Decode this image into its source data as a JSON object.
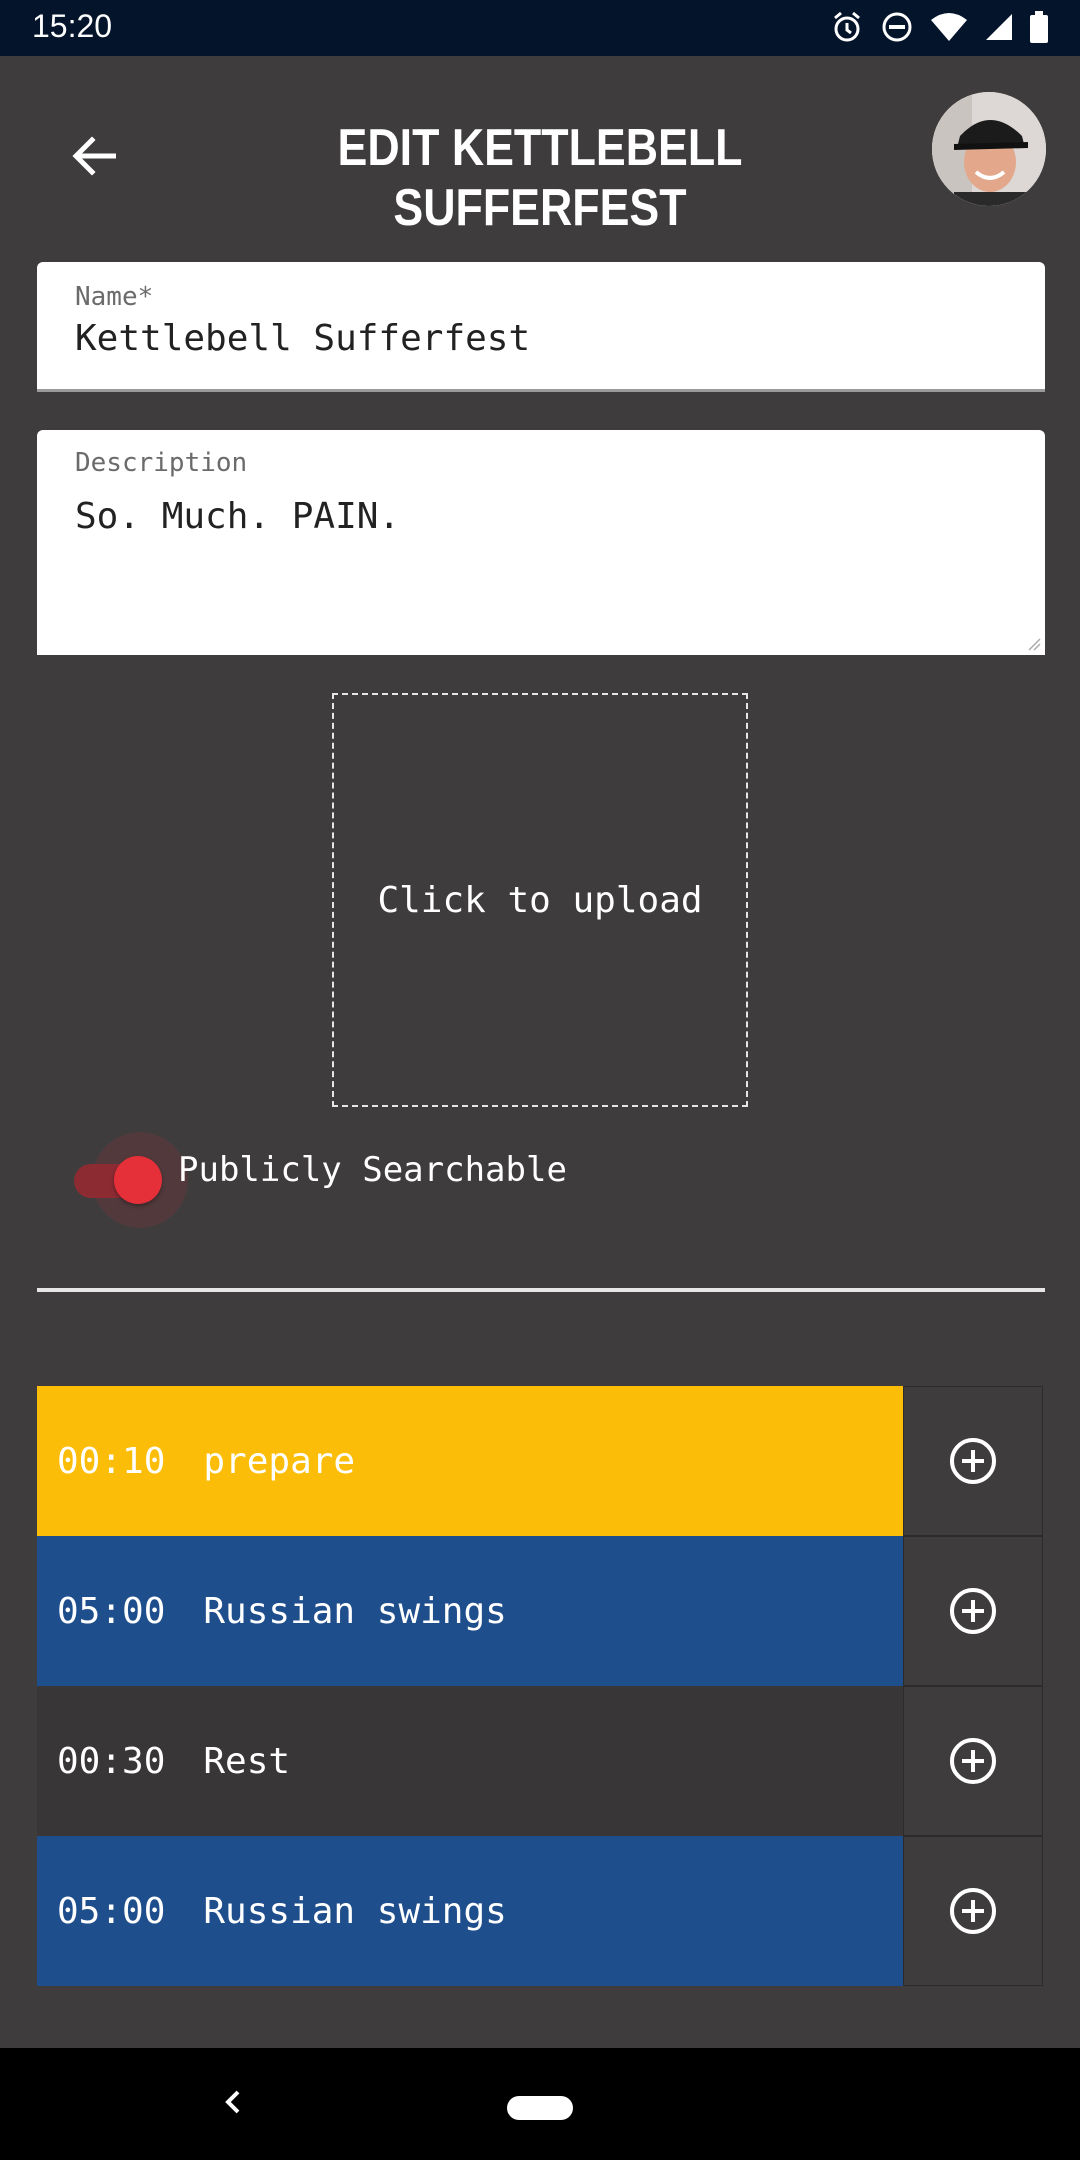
{
  "status_bar": {
    "time": "15:20",
    "icons": [
      "alarm-icon",
      "do-not-disturb-icon",
      "wifi-icon",
      "signal-icon",
      "battery-icon"
    ]
  },
  "header": {
    "title": "EDIT KETTLEBELL SUFFERFEST",
    "back_icon": "arrow-left-icon",
    "avatar": "user-avatar"
  },
  "form": {
    "name_label": "Name*",
    "name_value": "Kettlebell Sufferfest",
    "description_label": "Description",
    "description_value": "So. Much. PAIN.",
    "upload_label": "Click to upload",
    "public_label": "Publicly Searchable",
    "public_on": true
  },
  "intervals": [
    {
      "time": "00:10",
      "name": "prepare",
      "color": "#fbbd08"
    },
    {
      "time": "05:00",
      "name": "Russian swings",
      "color": "#1f4e8c"
    },
    {
      "time": "00:30",
      "name": "Rest",
      "color": "#383637"
    },
    {
      "time": "05:00",
      "name": "Russian swings",
      "color": "#1f4e8c"
    }
  ],
  "colors": {
    "background": "#3e3c3d",
    "status_bar": "#04142a",
    "toggle_accent": "#e5303a"
  }
}
